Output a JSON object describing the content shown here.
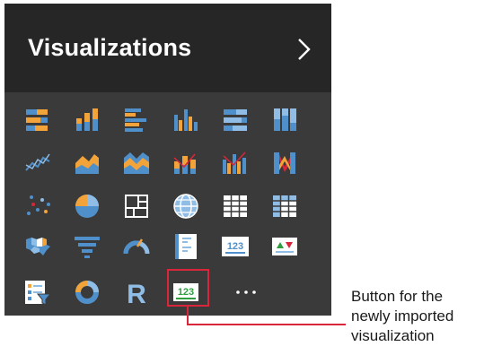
{
  "panel": {
    "title": "Visualizations",
    "collapse_icon": "chevron-right-icon"
  },
  "gallery": [
    [
      "stacked-bar-chart-icon",
      "stacked-column-chart-icon",
      "clustered-bar-chart-icon",
      "clustered-column-chart-icon",
      "100-stacked-bar-chart-icon",
      "100-stacked-column-chart-icon"
    ],
    [
      "line-chart-icon",
      "area-chart-icon",
      "stacked-area-chart-icon",
      "line-and-stacked-column-chart-icon",
      "line-and-clustered-column-chart-icon",
      "ribbon-chart-icon"
    ],
    [
      "scatter-chart-icon",
      "pie-chart-icon",
      "treemap-icon",
      "map-icon",
      "table-icon",
      "matrix-icon"
    ],
    [
      "filled-map-icon",
      "funnel-icon",
      "gauge-icon",
      "multi-row-card-icon",
      "card-icon",
      "kpi-icon"
    ],
    [
      "slicer-icon",
      "donut-chart-icon",
      "r-script-visual-icon",
      "imported-custom-visual-icon",
      "more-options-icon"
    ]
  ],
  "glyphs": {
    "card_number": "123",
    "r_letter": "R",
    "more_dots": "···"
  },
  "colors": {
    "panel_background": "#3a3a3a",
    "header_background": "#262626",
    "orange": "#f2a33a",
    "blue": "#4f8fca",
    "light_blue": "#8fbde6",
    "callout_red": "#d9263a",
    "imported_green": "#2e9e3e"
  },
  "callout": {
    "lines": [
      "Button for the",
      "newly imported",
      "visualization"
    ]
  }
}
